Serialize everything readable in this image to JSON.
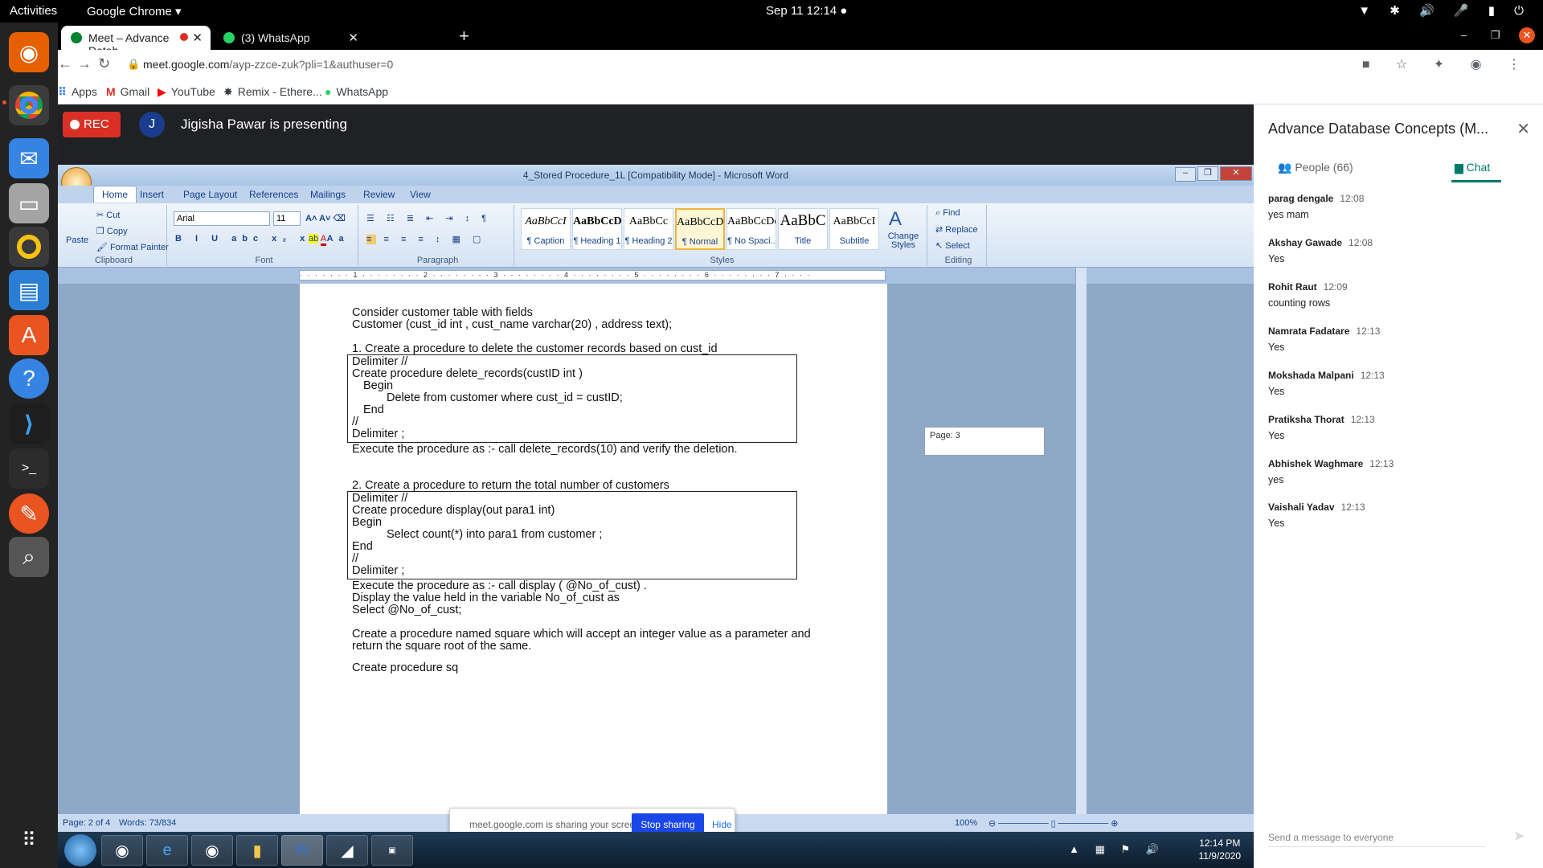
{
  "system_bar": {
    "activities": "Activities",
    "app_menu": "Google Chrome ▾",
    "clock": "Sep 11  12:14  ●"
  },
  "browser": {
    "tabs": [
      {
        "title": "Meet – Advance Datab",
        "active": true
      },
      {
        "title": "(3) WhatsApp",
        "active": false
      }
    ],
    "url_host": "meet.google.com",
    "url_path": "/ayp-zzce-zuk?pli=1&authuser=0",
    "bookmarks": [
      "Apps",
      "Gmail",
      "YouTube",
      "Remix - Ethere...",
      "WhatsApp"
    ]
  },
  "meet": {
    "rec_label": "REC",
    "presenter_initial": "J",
    "presenting_text": "Jigisha Pawar is presenting",
    "share_bar": {
      "text": "meet.google.com is sharing your screen.",
      "stop": "Stop sharing",
      "hide": "Hide"
    }
  },
  "word": {
    "title": "4_Stored Procedure_1L [Compatibility Mode] - Microsoft Word",
    "ribbon_tabs": [
      "Home",
      "Insert",
      "Page Layout",
      "References",
      "Mailings",
      "Review",
      "View"
    ],
    "clipboard": {
      "paste": "Paste",
      "cut": "Cut",
      "copy": "Copy",
      "format_painter": "Format Painter",
      "label": "Clipboard"
    },
    "font": {
      "name": "Arial",
      "size": "11",
      "label": "Font"
    },
    "paragraph_label": "Paragraph",
    "styles": [
      {
        "preview": "AaBbCcI",
        "name": "¶ Caption"
      },
      {
        "preview": "AaBbCcD",
        "name": "¶ Heading 1"
      },
      {
        "preview": "AaBbCc",
        "name": "¶ Heading 2"
      },
      {
        "preview": "AaBbCcDc",
        "name": "¶ Normal"
      },
      {
        "preview": "AaBbCcDc",
        "name": "¶ No Spaci..."
      },
      {
        "preview": "AaBbC",
        "name": "Title"
      },
      {
        "preview": "AaBbCcI",
        "name": "Subtitle"
      }
    ],
    "styles_label": "Styles",
    "change_styles": "Change Styles",
    "editing": {
      "find": "Find",
      "replace": "Replace",
      "select": "Select",
      "label": "Editing"
    },
    "page_tip": "Page: 3",
    "status": {
      "page": "Page: 2 of 4",
      "words": "Words: 73/834",
      "zoom": "100%"
    },
    "doc": {
      "intro1": "Consider customer table with fields",
      "intro2": "Customer (cust_id int , cust_name varchar(20) , address text);",
      "q1": "1. Create a procedure to delete the customer records based on cust_id",
      "box1": [
        "Delimiter //",
        "Create procedure delete_records(custID int )",
        "Begin",
        "Delete from customer  where cust_id = custID;",
        "End",
        "//",
        "Delimiter ;"
      ],
      "exec1": "Execute the procedure as :-   call delete_records(10) and verify the deletion.",
      "q2": "2. Create a procedure to return the total number of customers",
      "box2": [
        "Delimiter //",
        "Create procedure display(out para1 int)",
        "Begin",
        "Select count(*)  into para1  from customer ;",
        "End",
        "//",
        "Delimiter ;"
      ],
      "exec2": "Execute the procedure as :-   call  display ( @No_of_cust) .",
      "display": "Display the  value held in the variable No_of_cust as",
      "select": "Select @No_of_cust;",
      "q3a": "Create a procedure named square which will accept an integer value as a parameter and",
      "q3b": "return the square root of the same.",
      "cut": "Create procedure sq"
    },
    "taskbar_clock": {
      "time": "12:14 PM",
      "date": "11/9/2020"
    }
  },
  "panel": {
    "title": "Advance Database Concepts (M...",
    "people_tab": "People (66)",
    "chat_tab": "Chat",
    "messages": [
      {
        "name": "parag dengale",
        "time": "12:08",
        "text": "yes mam"
      },
      {
        "name": "Akshay Gawade",
        "time": "12:08",
        "text": "Yes"
      },
      {
        "name": "Rohit Raut",
        "time": "12:09",
        "text": "counting rows"
      },
      {
        "name": "Namrata Fadatare",
        "time": "12:13",
        "text": "Yes"
      },
      {
        "name": "Mokshada Malpani",
        "time": "12:13",
        "text": "Yes"
      },
      {
        "name": "Pratiksha Thorat",
        "time": "12:13",
        "text": "Yes"
      },
      {
        "name": "Abhishek Waghmare",
        "time": "12:13",
        "text": "yes"
      },
      {
        "name": "Vaishali Yadav",
        "time": "12:13",
        "text": "Yes"
      }
    ],
    "send_placeholder": "Send a message to everyone"
  }
}
